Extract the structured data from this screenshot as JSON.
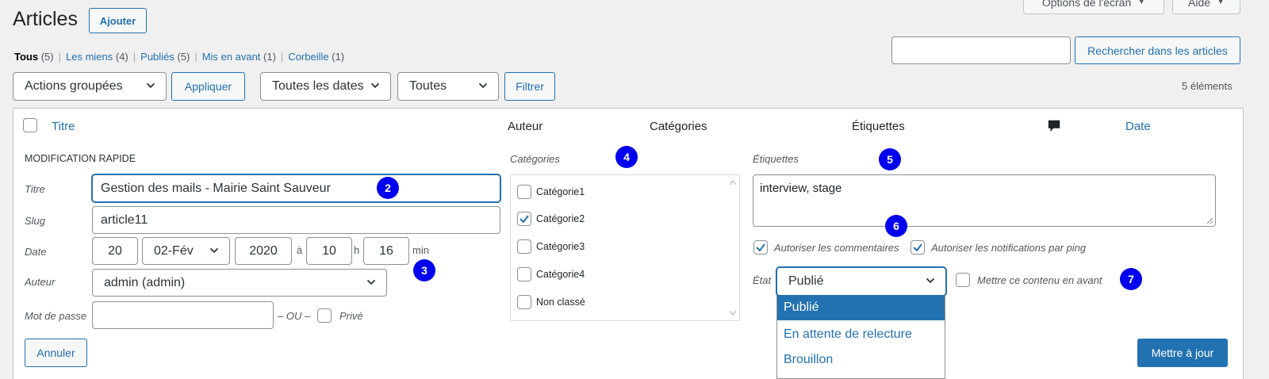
{
  "header": {
    "title": "Articles",
    "add_button": "Ajouter",
    "screen_options": "Options de l'écran",
    "help": "Aide"
  },
  "filters": {
    "all_label": "Tous",
    "all_count": "(5)",
    "mine_label": "Les miens",
    "mine_count": "(4)",
    "published_label": "Publiés",
    "published_count": "(5)",
    "sticky_label": "Mis en avant",
    "sticky_count": "(1)",
    "trash_label": "Corbeille",
    "trash_count": "(1)",
    "separator": "|"
  },
  "search": {
    "button": "Rechercher dans les articles",
    "value": ""
  },
  "toolbar": {
    "bulk_actions": "Actions groupées",
    "apply": "Appliquer",
    "all_dates": "Toutes les dates",
    "all_categories": "Toutes",
    "filter": "Filtrer",
    "item_count": "5 éléments"
  },
  "columns": {
    "title": "Titre",
    "author": "Auteur",
    "categories": "Catégories",
    "tags": "Étiquettes",
    "date": "Date",
    "comments_icon": "comment-bubble-icon"
  },
  "quick_edit": {
    "heading": "MODIFICATION RAPIDE",
    "title_label": "Titre",
    "title_value": "Gestion des mails - Mairie Saint Sauveur",
    "slug_label": "Slug",
    "slug_value": "article11",
    "date_label": "Date",
    "day": "20",
    "month": "02-Fév",
    "year": "2020",
    "at": "à",
    "hour": "10",
    "h": "h",
    "minute": "16",
    "min": "min",
    "author_label": "Auteur",
    "author_value": "admin (admin)",
    "password_label": "Mot de passe",
    "password_value": "",
    "or": "– OU –",
    "private": "Privé",
    "cancel": "Annuler",
    "update": "Mettre à jour",
    "categories_label": "Catégories",
    "categories": [
      {
        "name": "Catégorie1",
        "checked": false
      },
      {
        "name": "Catégorie2",
        "checked": true
      },
      {
        "name": "Catégorie3",
        "checked": false
      },
      {
        "name": "Catégorie4",
        "checked": false
      },
      {
        "name": "Non classé",
        "checked": false
      }
    ],
    "tags_label": "Étiquettes",
    "tags_value": "interview, stage",
    "allow_comments": "Autoriser les commentaires",
    "allow_pings": "Autoriser les notifications par ping",
    "status_label": "État",
    "status_value": "Publié",
    "sticky": "Mettre ce contenu en avant",
    "status_options": [
      "Publié",
      "En attente de relecture",
      "Brouillon"
    ]
  },
  "badges": [
    "2",
    "3",
    "4",
    "5",
    "6",
    "7"
  ],
  "colors": {
    "accent": "#2271b1",
    "badge": "#0000ee",
    "background": "#f0f0f1"
  }
}
